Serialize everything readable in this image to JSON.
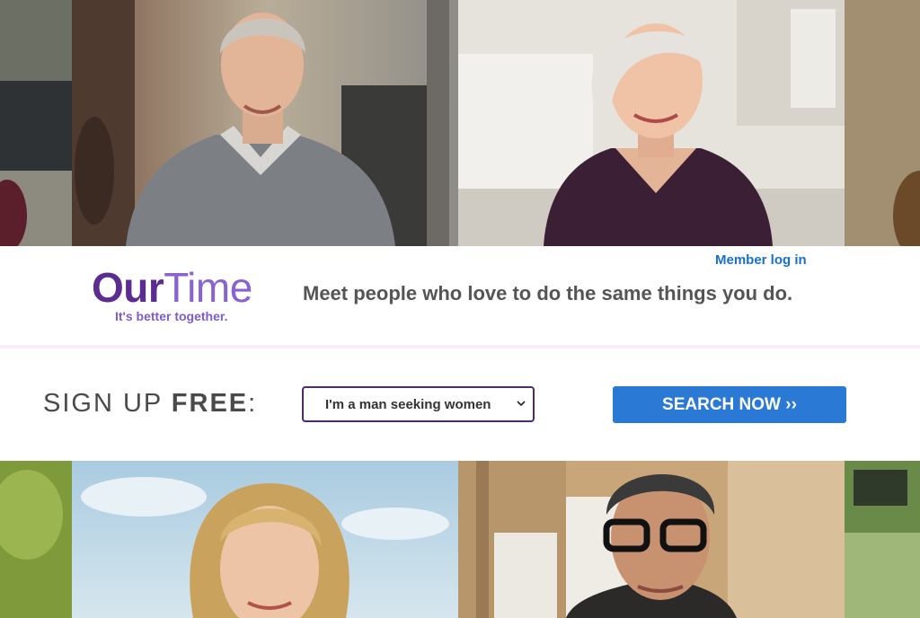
{
  "header": {
    "member_login": "Member log in",
    "logo_our": "Our",
    "logo_time": "Time",
    "tagline": "It's better together.",
    "headline": "Meet people who love to do the same things you do."
  },
  "signup": {
    "label_light": "SIGN UP ",
    "label_bold": "FREE",
    "label_colon": ":",
    "seeking_value": "I'm a man seeking women",
    "search_button": "SEARCH NOW ››"
  },
  "colors": {
    "brand_purple": "#5c2d91",
    "brand_light_purple": "#8a63d2",
    "link_blue": "#1a6fc9",
    "button_blue": "#2a79d4"
  },
  "photos": [
    {
      "row": "top",
      "subject": "man-gray-sweater-street"
    },
    {
      "row": "top",
      "subject": "woman-white-hair-kitchen"
    },
    {
      "row": "bottom",
      "subject": "woman-blonde-outdoors"
    },
    {
      "row": "bottom",
      "subject": "man-glasses-studio"
    }
  ]
}
